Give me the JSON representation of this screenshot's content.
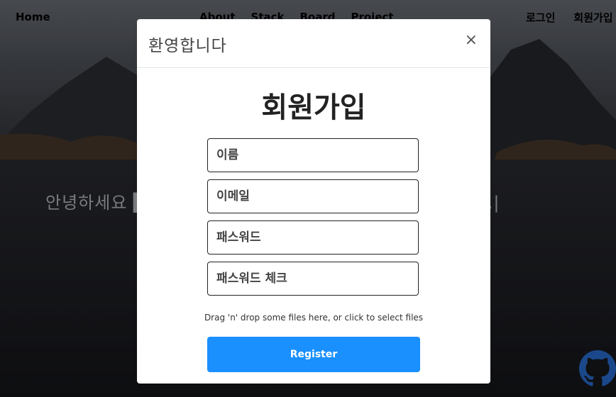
{
  "nav": {
    "home": "Home",
    "center_items": [
      "About",
      "Stack",
      "Board",
      "Project"
    ],
    "right_items": [
      "로그인",
      "회원가입"
    ]
  },
  "hero": {
    "text": "안녕하세요 ████████████████████ 오 입니다.|"
  },
  "modal": {
    "title": "환영합니다",
    "close": "×",
    "form_title": "회원가입",
    "fields": {
      "name_placeholder": "이름",
      "email_placeholder": "이메일",
      "password_placeholder": "패스워드",
      "password_check_placeholder": "패스워드 체크"
    },
    "dropzone": "Drag 'n' drop some files here, or click to select files",
    "register": "Register"
  },
  "colors": {
    "accent": "#1a90ff",
    "overlay": "rgba(0,0,0,0.35)"
  },
  "icons": {
    "github": "github-icon"
  }
}
